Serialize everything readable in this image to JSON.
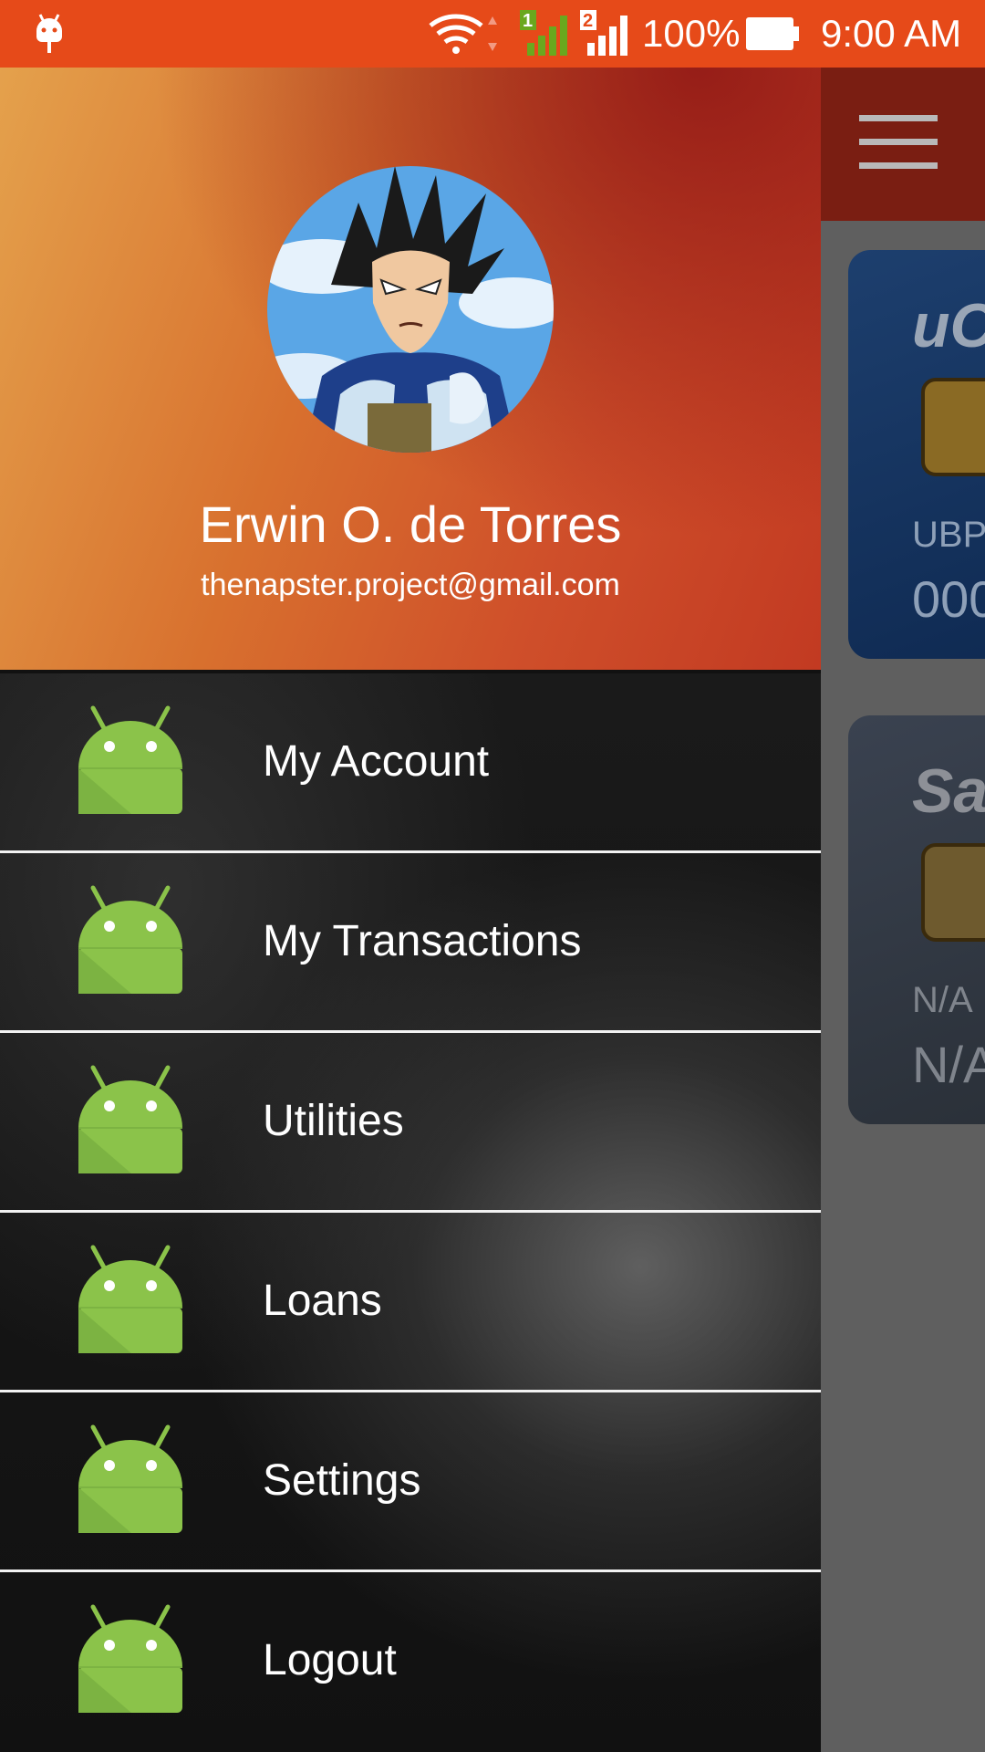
{
  "status_bar": {
    "debug_icon": "android-debug-icon",
    "wifi_icon": "wifi-icon",
    "sim1_label": "1",
    "sim2_label": "2",
    "battery_text": "100%",
    "time": "9:00 AM",
    "background_color": "#e64a19"
  },
  "drawer": {
    "user_name": "Erwin O. de Torres",
    "user_email": "thenapster.project@gmail.com",
    "items": [
      {
        "label": "My Account",
        "icon": "android-icon"
      },
      {
        "label": "My Transactions",
        "icon": "android-icon"
      },
      {
        "label": "Utilities",
        "icon": "android-icon"
      },
      {
        "label": "Loans",
        "icon": "android-icon"
      },
      {
        "label": "Settings",
        "icon": "android-icon"
      },
      {
        "label": "Logout",
        "icon": "android-icon"
      }
    ],
    "icon_color": "#8bc34a"
  },
  "background_app": {
    "menu_icon": "hamburger-menu-icon",
    "cards": [
      {
        "title": "uC",
        "label": "UBP",
        "value": "000"
      },
      {
        "title": "Sa",
        "label": "N/A",
        "value": "N/A"
      }
    ]
  }
}
